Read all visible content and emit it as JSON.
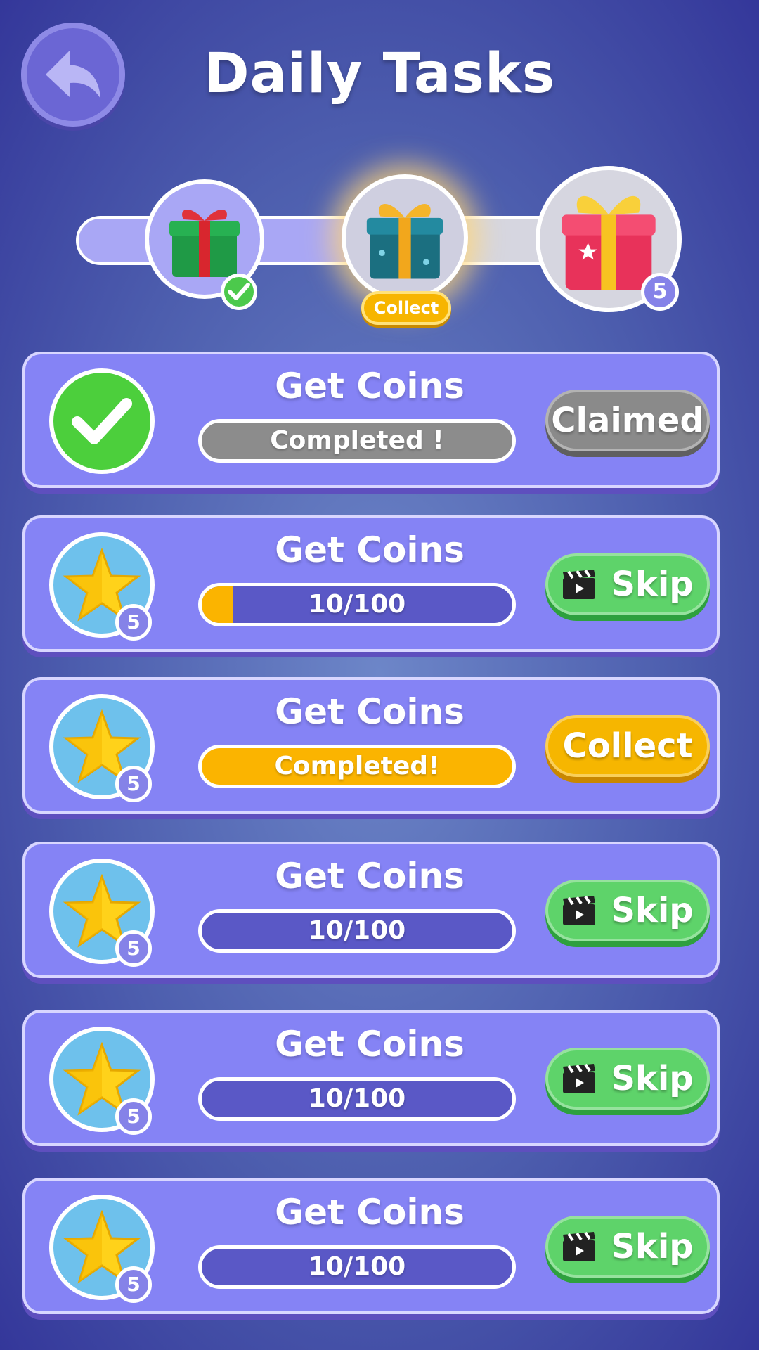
{
  "header": {
    "title": "Daily Tasks",
    "back_icon": "back-arrow-icon"
  },
  "milestones": {
    "progress_fraction": 0.5,
    "items": [
      {
        "icon": "green-gift-icon",
        "state": "claimed",
        "badge_icon": "check-icon"
      },
      {
        "icon": "teal-gift-icon",
        "state": "ready",
        "collect_label": "Collect"
      },
      {
        "icon": "pink-gift-icon",
        "state": "locked",
        "count": "5"
      }
    ]
  },
  "tasks": [
    {
      "title": "Get Coins",
      "icon": "check-icon",
      "progress_text": "Completed !",
      "progress_fraction": 1.0,
      "bar": "gray",
      "button": "Claimed",
      "button_type": "claimed"
    },
    {
      "title": "Get Coins",
      "icon": "star-icon",
      "badge": "5",
      "progress_text": "10/100",
      "progress_fraction": 0.1,
      "bar": "purple",
      "button": "Skip",
      "button_type": "skip",
      "button_icon": "clapperboard-icon"
    },
    {
      "title": "Get Coins",
      "icon": "star-icon",
      "badge": "5",
      "progress_text": "Completed!",
      "progress_fraction": 1.0,
      "bar": "gold",
      "button": "Collect",
      "button_type": "collect"
    },
    {
      "title": "Get Coins",
      "icon": "star-icon",
      "badge": "5",
      "progress_text": "10/100",
      "progress_fraction": 0.0,
      "bar": "purple",
      "button": "Skip",
      "button_type": "skip",
      "button_icon": "clapperboard-icon"
    },
    {
      "title": "Get Coins",
      "icon": "star-icon",
      "badge": "5",
      "progress_text": "10/100",
      "progress_fraction": 0.0,
      "bar": "purple",
      "button": "Skip",
      "button_type": "skip",
      "button_icon": "clapperboard-icon"
    },
    {
      "title": "Get Coins",
      "icon": "star-icon",
      "badge": "5",
      "progress_text": "10/100",
      "progress_fraction": 0.0,
      "bar": "purple",
      "button": "Skip",
      "button_type": "skip",
      "button_icon": "clapperboard-icon"
    }
  ],
  "colors": {
    "card": "#8583f5",
    "gold": "#fbb400",
    "green": "#5ed36a",
    "gray": "#8a8a8a"
  }
}
